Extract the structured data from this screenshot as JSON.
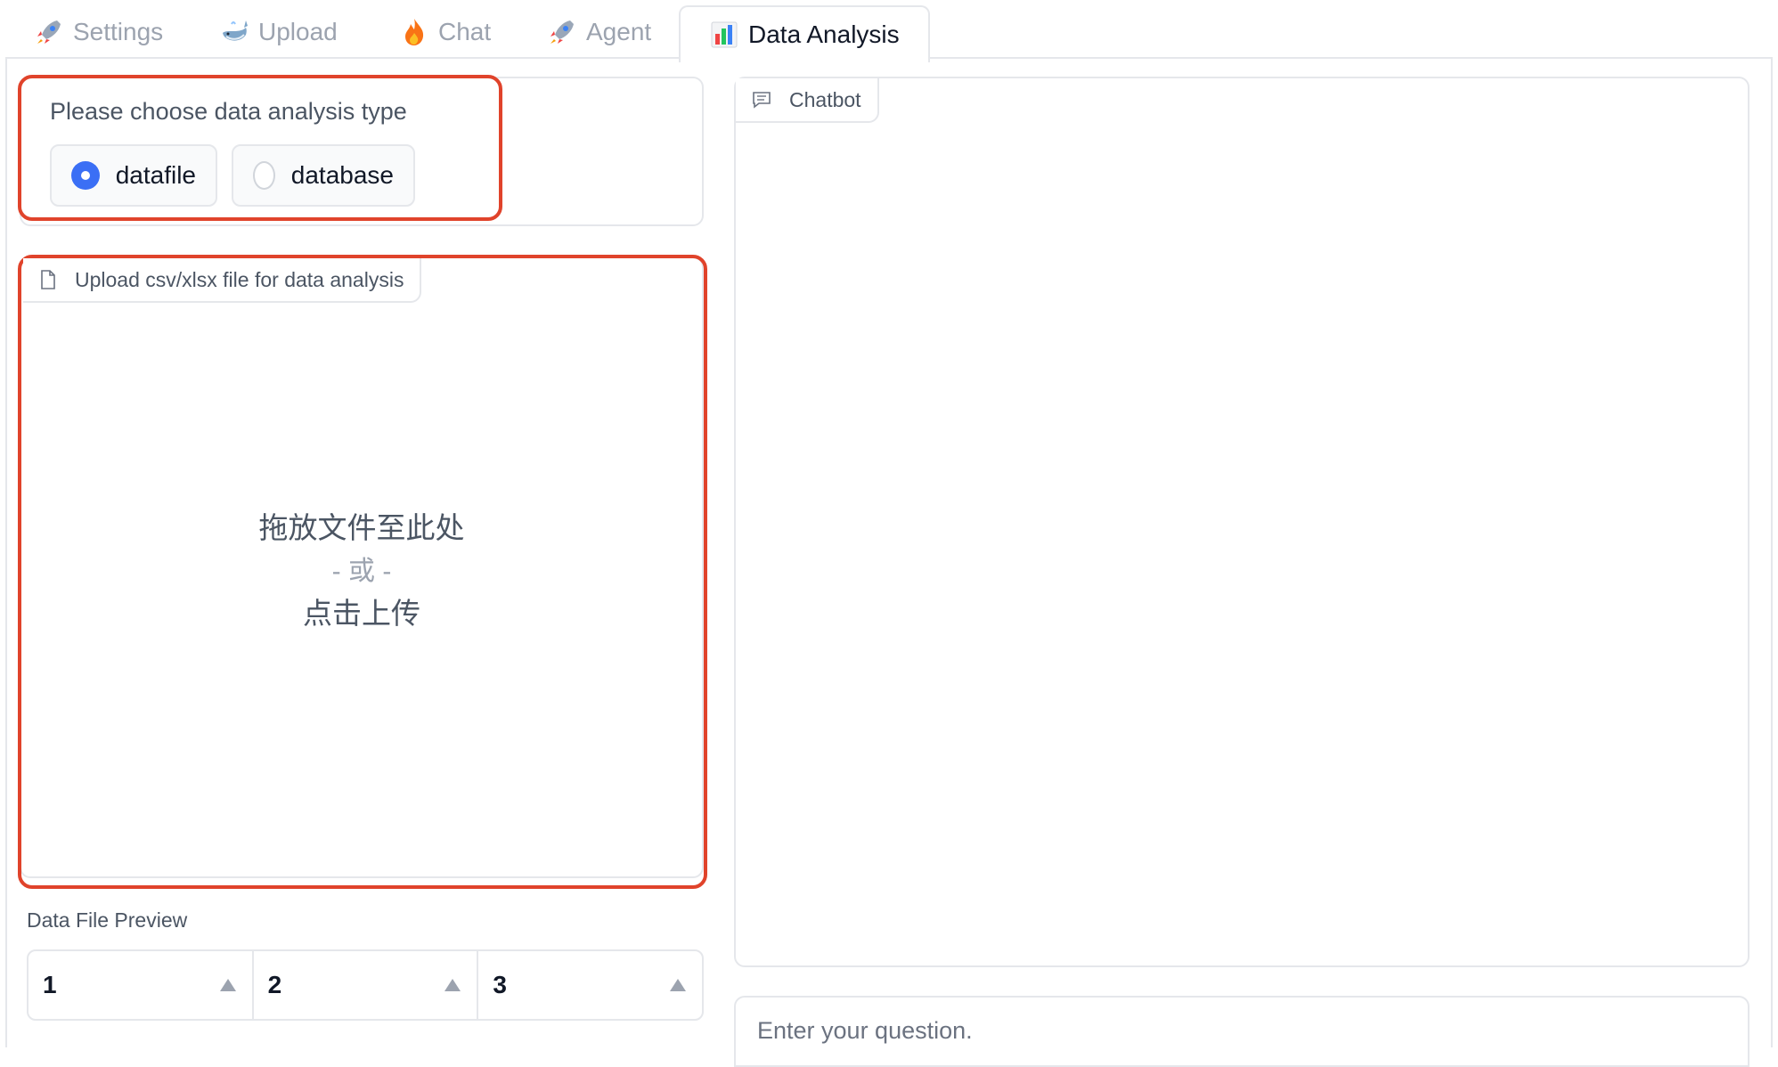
{
  "tabs": [
    {
      "label": "Settings",
      "icon": "rocket-icon"
    },
    {
      "label": "Upload",
      "icon": "whale-icon"
    },
    {
      "label": "Chat",
      "icon": "fire-icon"
    },
    {
      "label": "Agent",
      "icon": "rocket-icon"
    },
    {
      "label": "Data Analysis",
      "icon": "bar-chart-icon",
      "active": true
    }
  ],
  "analysis_type": {
    "title": "Please choose data analysis type",
    "options": [
      {
        "label": "datafile",
        "checked": true
      },
      {
        "label": "database",
        "checked": false
      }
    ]
  },
  "upload": {
    "label": "Upload csv/xlsx file for data analysis",
    "drop_line1": "拖放文件至此处",
    "drop_line2": "- 或 -",
    "drop_line3": "点击上传"
  },
  "preview": {
    "label": "Data File Preview",
    "columns": [
      "1",
      "2",
      "3"
    ]
  },
  "chatbot": {
    "label": "Chatbot"
  },
  "question": {
    "placeholder": "Enter your question."
  },
  "colors": {
    "accent": "#3b6ff5",
    "highlight": "#e0432b",
    "border": "#e5e7eb"
  }
}
